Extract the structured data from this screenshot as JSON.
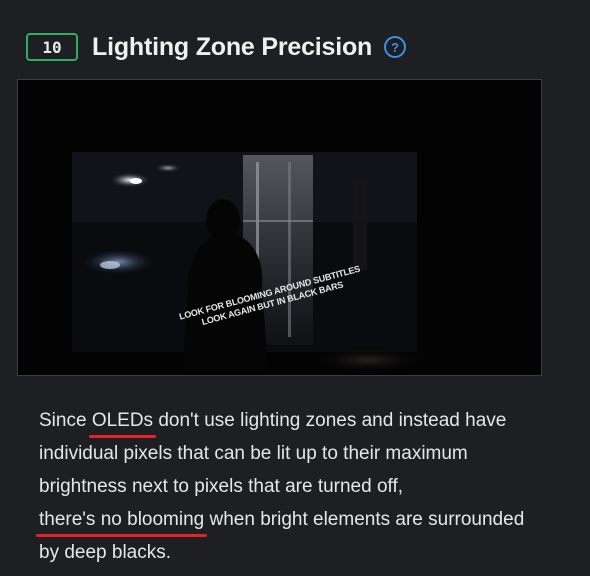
{
  "header": {
    "score": "10",
    "title": "Lighting Zone Precision",
    "help_icon": "question-circle-icon"
  },
  "test_image": {
    "subtitle_line1": "LOOK FOR BLOOMING AROUND SUBTITLES",
    "subtitle_line2": "LOOK AGAIN BUT IN BLACK BARS"
  },
  "description": {
    "part1": "Since ",
    "highlight1": "OLEDs",
    "part2": " don't use lighting zones and instead have individual pixels that can be lit up to their maximum brightness next to pixels that are turned off, ",
    "highlight2": "there's no blooming",
    "part3": " when bright elements are surrounded by deep blacks."
  },
  "colors": {
    "background": "#1d1f23",
    "badge_border": "#2fae5f",
    "help_icon": "#3f8fe8",
    "underline": "#e8222b"
  }
}
